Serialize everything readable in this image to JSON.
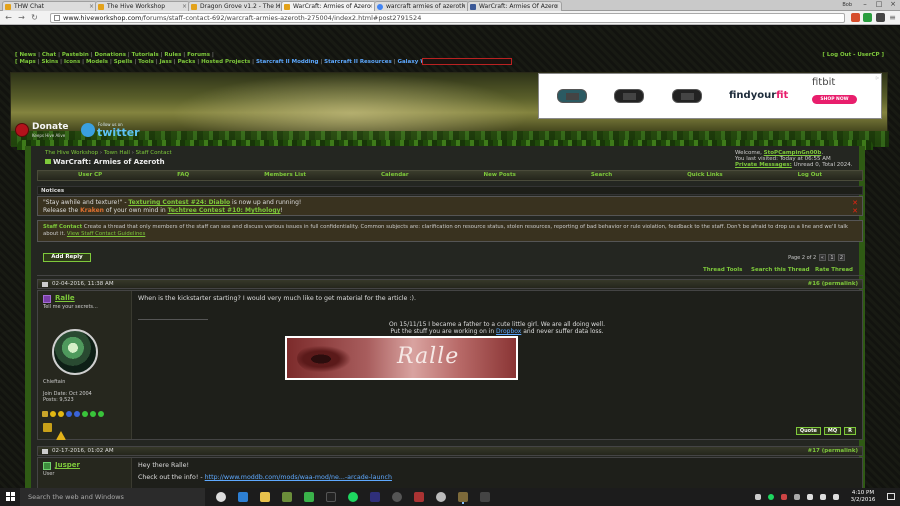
{
  "browser": {
    "tabs": [
      {
        "label": "THW Chat",
        "active": false
      },
      {
        "label": "The Hive Workshop",
        "active": false
      },
      {
        "label": "Dragon Grove v1.2 - The H",
        "active": false
      },
      {
        "label": "WarCraft: Armies of Azero",
        "active": true
      },
      {
        "label": "warcraft armies of azeroth",
        "active": false
      },
      {
        "label": "WarCraft: Armies Of Azero",
        "active": false
      }
    ],
    "user": "Bob",
    "url_host": "www.hiveworkshop.com",
    "url_path": "/forums/staff-contact-692/warcraft-armies-azeroth-275004/index2.html#post2791524"
  },
  "site": {
    "top_links_row1": [
      "News",
      "Chat",
      "Pastebin",
      "Donations",
      "Tutorials",
      "Rules",
      "Forums"
    ],
    "top_links_row2": [
      "Maps",
      "Skins",
      "Icons",
      "Models",
      "Spells",
      "Tools",
      "Jass",
      "Packs",
      "Hosted Projects"
    ],
    "top_links_blue": [
      "Starcraft II Modding",
      "Starcraft II Resources",
      "Galaxy Wiki"
    ],
    "logout": "[ Log Out - UserCP ]",
    "donate": {
      "title": "Donate",
      "sub": "Keeps Hive Alive"
    },
    "twitter": {
      "pre": "Follow us on",
      "title": "twitter"
    }
  },
  "ad": {
    "brand": "fitbit",
    "headline_a": "findyour",
    "headline_b": "fit",
    "button": "SHOP NOW",
    "adchoices": "AdChoices"
  },
  "forum": {
    "breadcrumb": [
      "The Hive Workshop",
      "Town Hall",
      "Staff Contact"
    ],
    "thread_title": "WarCraft: Armies of Azeroth",
    "welcome_prefix": "Welcome,",
    "welcome_user": "StoPCampinGn00b",
    "last_visited": "You last visited: Today at 06:55 AM",
    "pm_label": "Private Messages:",
    "pm_status": "Unread 0, Total 2024.",
    "nav": [
      "User CP",
      "FAQ",
      "Members List",
      "Calendar",
      "New Posts",
      "Search",
      "Quick Links",
      "Log Out"
    ],
    "notices_title": "Notices",
    "notice1": {
      "quote": "\"Stay awhile and texture!\"",
      "dash": " - ",
      "link": "Texturing Contest #24: Diablo",
      "rest": " is now up and running!"
    },
    "notice2": {
      "pre": "Release the ",
      "kraken": "Kraken",
      "mid": " of your own mind in ",
      "link": "Techtree Contest #10: Mythology",
      "post": "!"
    },
    "staff_title": "Staff Contact",
    "staff_text": "Create a thread that only members of the staff can see and discuss various issues in full confidentiality. Common subjects are: clarification on resource status, stolen resources, reporting of bad behavior or rule violation, feedback to the staff. Don't be afraid to drop us a line and we'll talk about it.",
    "staff_link": "View Staff Contact Guidelines",
    "add_reply": "Add Reply",
    "pager_label": "Page 2 of 2",
    "pager_pages": [
      "«",
      "1",
      "2"
    ],
    "tools": [
      "Thread Tools",
      "Search this Thread",
      "Rate Thread"
    ]
  },
  "posts": [
    {
      "date": "02-04-2016, 11:38 AM",
      "number": "#16",
      "permalink": "(permalink)",
      "author": "Ralle",
      "usertitle": "Tell me your secrets...",
      "rank": "Chieftain",
      "join": "Join Date: Oct 2004",
      "posts": "Posts: 9,523",
      "text": "When is the kickstarter starting? I would very much like to get material for the article :).",
      "sig1": "On 15/11/15 I became a father to a cute little girl. We are all doing well.",
      "sig2_pre": "Put the stuff you are working on in ",
      "sig2_link": "Dropbox",
      "sig2_post": " and never suffer data loss.",
      "sig_image_text": "Ralle",
      "buttons": [
        "Quote",
        "MQ",
        "R"
      ]
    },
    {
      "date": "02-17-2016, 01:02 AM",
      "number": "#17",
      "permalink": "(permalink)",
      "author": "Jusper",
      "usertitle": "User",
      "text": "Hey there Ralle!",
      "text2_pre": "Check out the info! - ",
      "text2_link": "http://www.moddb.com/mods/waa-mod/ne...-arcade-launch"
    }
  ],
  "taskbar": {
    "search_placeholder": "Search the web and Windows",
    "time": "4:10 PM",
    "date": "3/2/2016"
  },
  "colors": {
    "accent_green": "#7ec93b",
    "link_blue": "#5ea9ff",
    "notice_bg": "#39321f"
  }
}
